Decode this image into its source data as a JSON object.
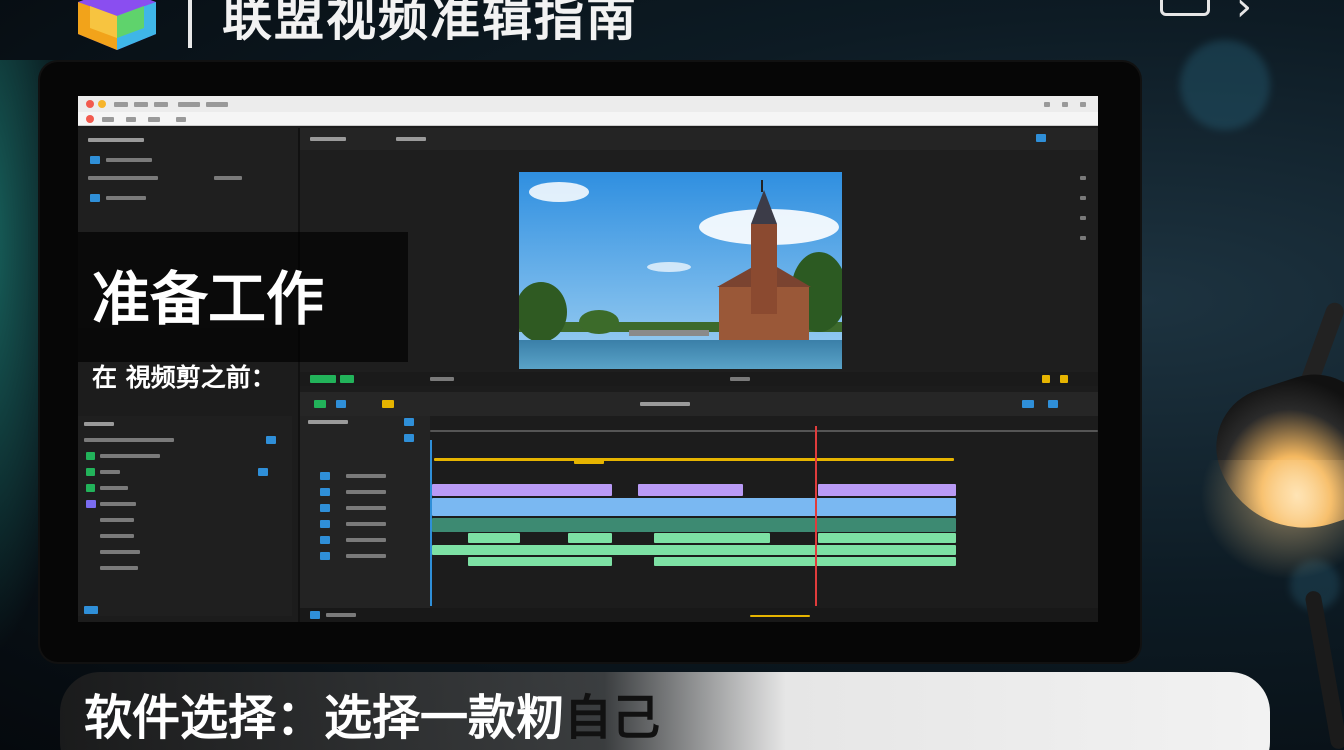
{
  "header": {
    "title": "联盟视频准辑指南"
  },
  "overlay": {
    "section_title": "准备工作",
    "section_sub": "在 視频剪之前：",
    "bottom_white": "软件选择：选择一款",
    "bottom_mid": "籾",
    "bottom_dark": "自己"
  },
  "icons": {
    "logo": "cube-logo-icon",
    "header_box": "screen-icon",
    "header_chevron": "chevron-right-icon"
  },
  "colors": {
    "accent_blue": "#2f8fd8",
    "track_purple": "#b99af5",
    "track_blue": "#7ab8f2",
    "track_green": "#7de0a4",
    "playhead_red": "#e03c3c",
    "bar_yellow": "#e6b400"
  }
}
